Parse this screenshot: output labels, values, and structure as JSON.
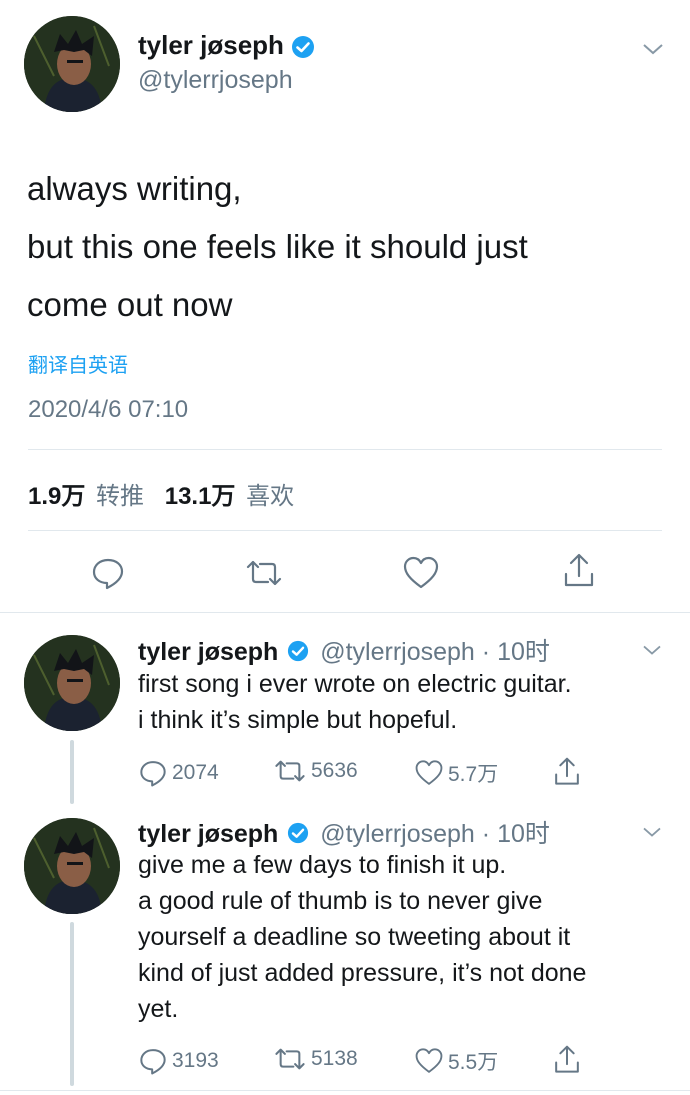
{
  "main_tweet": {
    "display_name": "tyler jøseph",
    "handle": "@tylerrjoseph",
    "lines": [
      "always writing,",
      "but this one feels like it should just",
      "come out now"
    ],
    "translate_link": "翻译自英语",
    "timestamp": "2020/4/6 07:10",
    "retweet_count": "1.9万",
    "retweet_label": "转推",
    "like_count": "13.1万",
    "like_label": "喜欢"
  },
  "replies": [
    {
      "display_name": "tyler jøseph",
      "handle": "@tylerrjoseph",
      "time": "· 10时",
      "lines": [
        "first song i ever wrote on electric guitar.",
        "i think it’s simple but hopeful."
      ],
      "reply_count": "2074",
      "retweet_count": "5636",
      "like_count": "5.7万"
    },
    {
      "display_name": "tyler jøseph",
      "handle": "@tylerrjoseph",
      "time": "· 10时",
      "lines": [
        "give me a few days to finish it up.",
        "a good rule of thumb is to never give",
        "yourself a deadline so tweeting about it",
        "kind of just added pressure, it’s not done",
        "yet."
      ],
      "reply_count": "3193",
      "retweet_count": "5138",
      "like_count": "5.5万"
    }
  ],
  "colors": {
    "verified": "#1da1f2",
    "link": "#1da1f2",
    "secondary": "#657786",
    "divider": "#e1e8ed"
  },
  "icons": [
    "verified-badge-icon",
    "chevron-down-icon",
    "reply-icon",
    "retweet-icon",
    "like-icon",
    "share-icon"
  ]
}
